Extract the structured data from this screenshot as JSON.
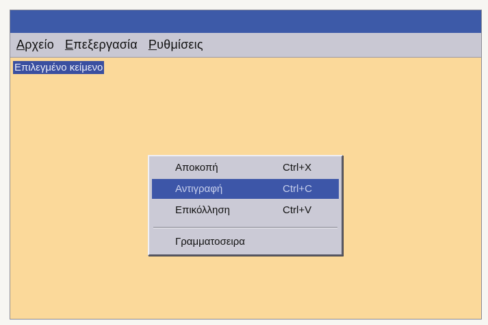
{
  "menubar": {
    "items": [
      "Αρχείο",
      "Επεξεργασία",
      "Ρυθμίσεις"
    ]
  },
  "editor": {
    "selected_text": "Επιλεγμένο κείμενο"
  },
  "context_menu": {
    "items": [
      {
        "label": "Αποκοπή",
        "shortcut": "Ctrl+X"
      },
      {
        "label": "Αντιγραφή",
        "shortcut": "Ctrl+C",
        "highlighted": true
      },
      {
        "label": "Επικόλληση",
        "shortcut": "Ctrl+V"
      },
      {
        "label": "Γραμματοσειρα",
        "shortcut": ""
      }
    ]
  },
  "colors": {
    "title_bar": "#3d5aa8",
    "menu_bar": "#c9c8d3",
    "content_bg": "#fbd99a",
    "selection": "#3a4fa0"
  }
}
